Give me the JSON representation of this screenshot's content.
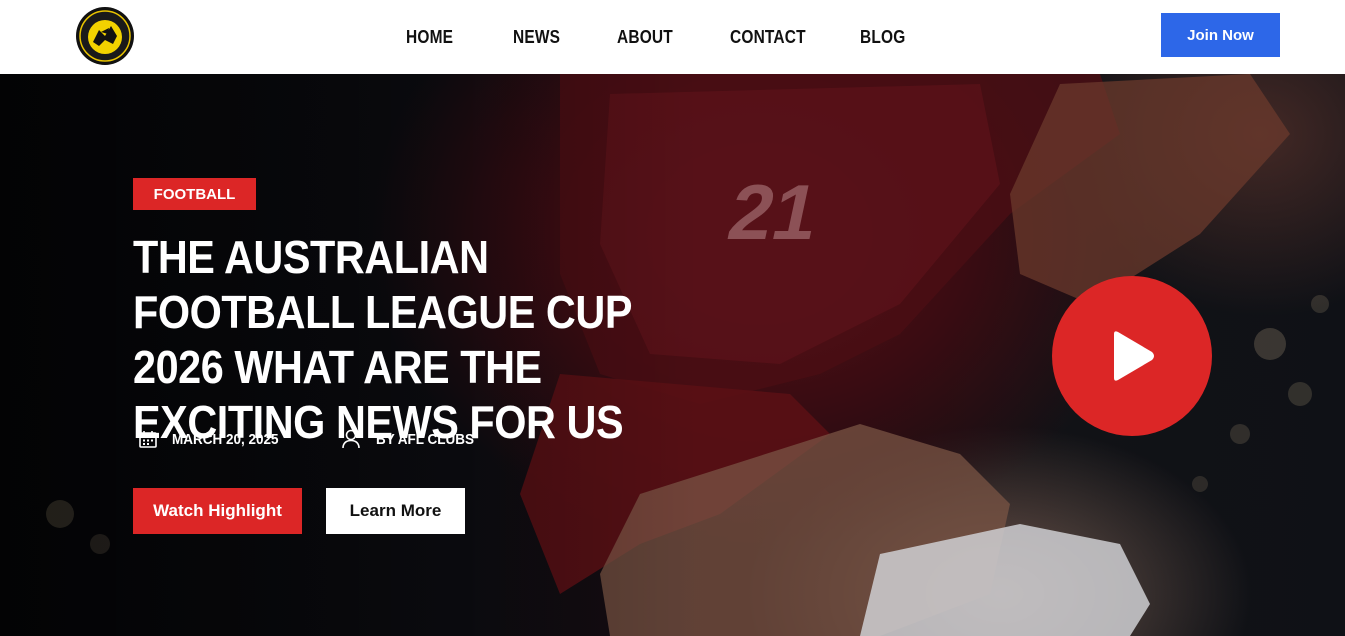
{
  "header": {
    "logo_alt": "Esports Football News logo",
    "nav": [
      {
        "label": "HOME"
      },
      {
        "label": "NEWS"
      },
      {
        "label": "ABOUT"
      },
      {
        "label": "CONTACT"
      },
      {
        "label": "BLOG"
      }
    ],
    "join_label": "Join Now",
    "join_color": "#2d67e8"
  },
  "hero": {
    "category": "FOOTBALL",
    "title": "THE AUSTRALIAN FOOTBALL LEAGUE CUP 2026 WHAT ARE THE EXCITING NEWS FOR US",
    "date": "MARCH 20, 2025",
    "author": "BY AFL CLUBS",
    "watch_label": "Watch Highlight",
    "learn_label": "Learn More",
    "background_jersey_number": "21",
    "accent_color": "#dc2626"
  },
  "icons": {
    "calendar": "calendar-icon",
    "user": "user-icon",
    "play": "play-icon"
  }
}
